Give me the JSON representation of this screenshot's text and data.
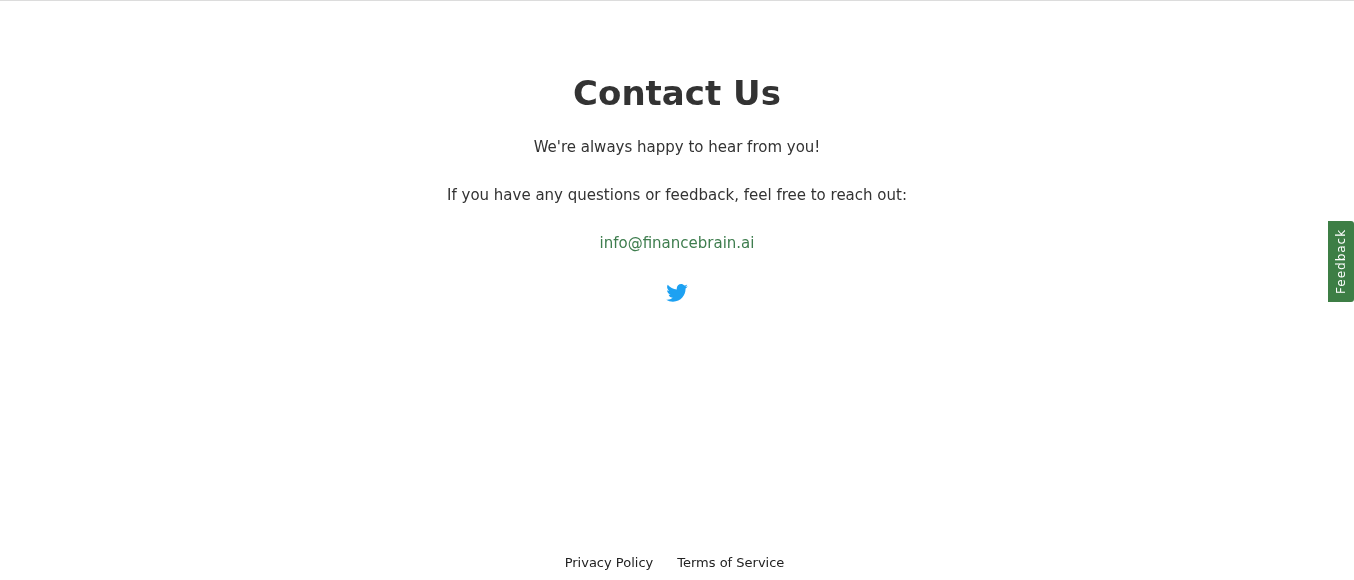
{
  "heading": "Contact Us",
  "paragraphs": [
    "We're always happy to hear from you!",
    "If you have any questions or feedback, feel free to reach out:"
  ],
  "email": "info@financebrain.ai",
  "feedback_tab": "Feedback",
  "footer_links": [
    "Privacy Policy",
    "Terms of Service"
  ]
}
